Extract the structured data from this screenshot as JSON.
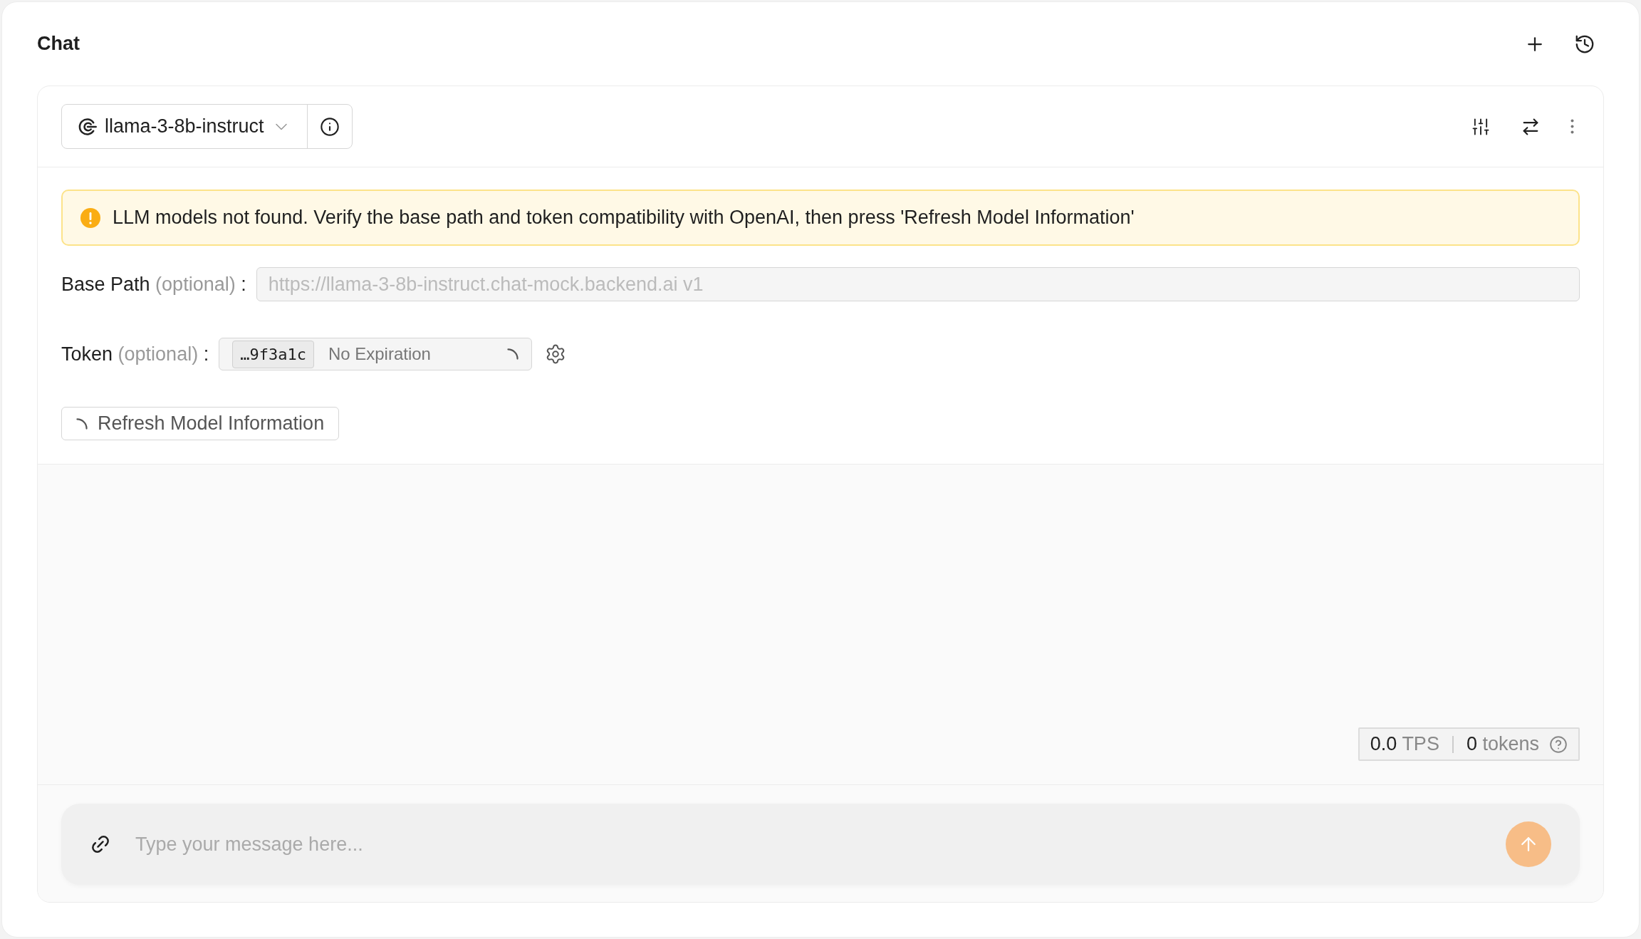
{
  "title": "Chat",
  "model_selector": {
    "value": "llama-3-8b-instruct"
  },
  "alert": {
    "message": "LLM models not found. Verify the base path and token compatibility with OpenAI, then press 'Refresh Model Information'"
  },
  "base_path": {
    "label": "Base Path",
    "hint": "(optional)",
    "colon": ":",
    "placeholder": "https://llama-3-8b-instruct.chat-mock.backend.ai v1"
  },
  "token": {
    "label": "Token",
    "hint": "(optional)",
    "colon": ":",
    "value": "…9f3a1c",
    "expiration": "No Expiration",
    "loading": true
  },
  "refresh_button": {
    "label": "Refresh Model Information",
    "loading": true
  },
  "stats": {
    "tps_value": "0.0",
    "tps_unit": "TPS",
    "tokens_value": "0",
    "tokens_unit": "tokens"
  },
  "message_input": {
    "placeholder": "Type your message here..."
  }
}
